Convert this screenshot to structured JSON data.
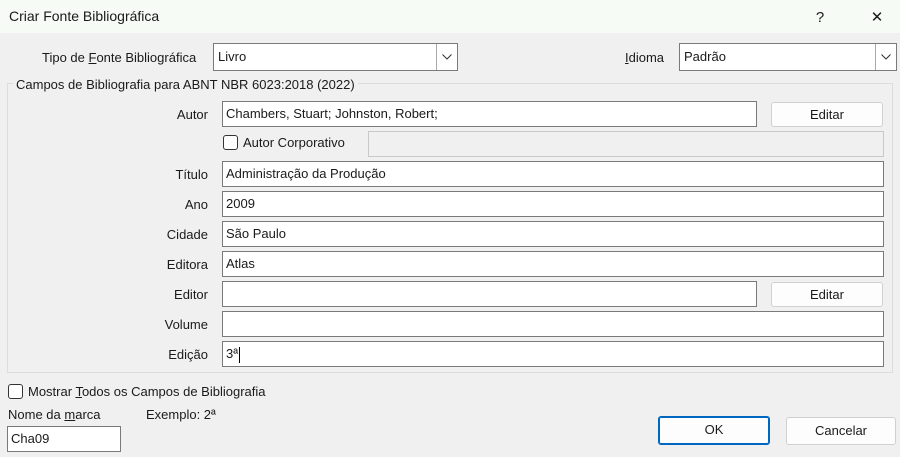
{
  "window": {
    "title": "Criar Fonte Bibliográfica",
    "help_label": "?",
    "close_label": "✕"
  },
  "source_type": {
    "label_pre": "Tipo de ",
    "label_underlined": "F",
    "label_post": "onte Bibliográfica",
    "value": "Livro"
  },
  "language": {
    "label_underlined": "I",
    "label_post": "dioma",
    "value": "Padrão"
  },
  "group": {
    "label": "Campos de Bibliografia para ABNT NBR 6023:2018 (2022)"
  },
  "fields": {
    "author": {
      "label": "Autor",
      "value": "Chambers, Stuart; Johnston, Robert;"
    },
    "author_edit": "Editar",
    "corporate_author": {
      "label": "Autor Corporativo",
      "value": "",
      "checked": false
    },
    "title": {
      "label": "Título",
      "value": "Administração da Produção"
    },
    "year": {
      "label": "Ano",
      "value": "2009"
    },
    "city": {
      "label": "Cidade",
      "value": "São Paulo"
    },
    "publisher": {
      "label": "Editora",
      "value": "Atlas"
    },
    "editor": {
      "label": "Editor",
      "value": ""
    },
    "editor_edit": "Editar",
    "volume": {
      "label": "Volume",
      "value": ""
    },
    "edition": {
      "label": "Edição",
      "value": "3ª"
    }
  },
  "show_all": {
    "label_pre": "Mostrar ",
    "label_underlined": "T",
    "label_post": "odos os Campos de Bibliografia",
    "checked": false
  },
  "tag": {
    "label_pre": "Nome da ",
    "label_underlined": "m",
    "label_post": "arca",
    "value": "Cha09"
  },
  "example": "Exemplo: 2ª",
  "buttons": {
    "ok": "OK",
    "cancel": "Cancelar"
  },
  "colors": {
    "accent": "#0067c0",
    "titlebar": "#f6fbf5",
    "background": "#f0f0f0"
  }
}
